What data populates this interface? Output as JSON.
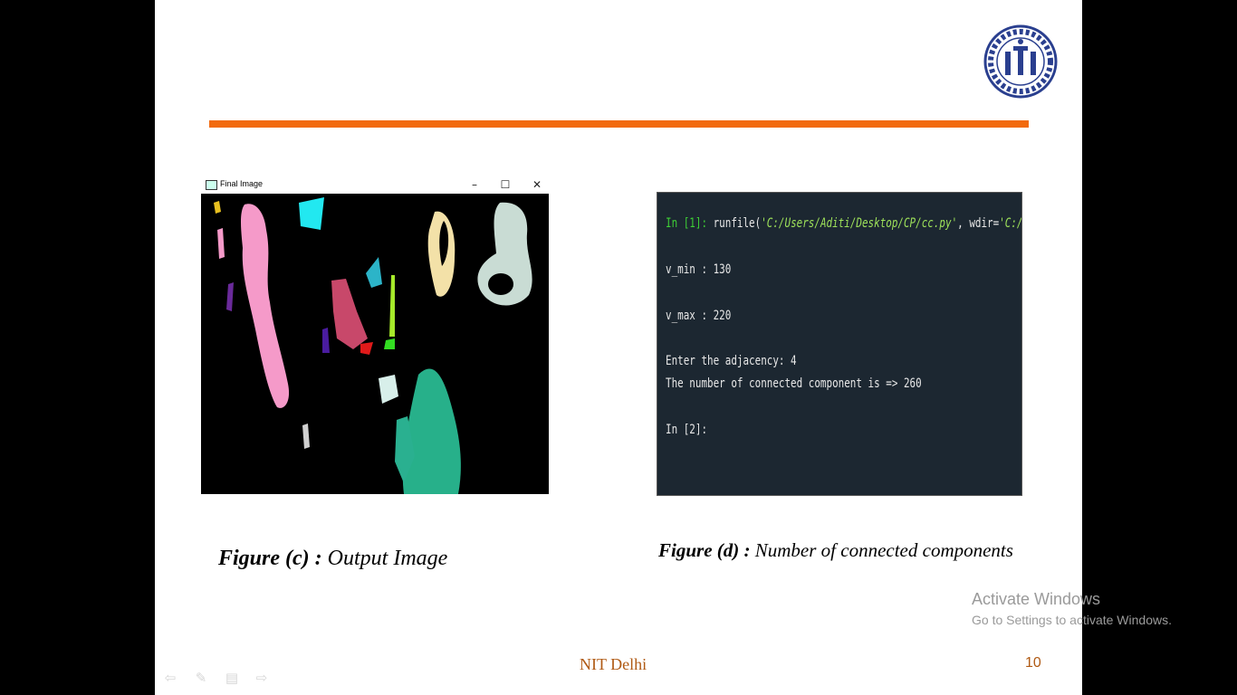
{
  "window": {
    "title": "Final Image",
    "minimize_symbol": "–",
    "maximize_symbol": "☐",
    "close_symbol": "✕"
  },
  "console": {
    "lines": [
      {
        "prompt": "In [1]:",
        "code_pre": " runfile(",
        "str1": "'C:/Users/Aditi/Desktop/CP/cc.py'",
        "code_mid": ", wdir=",
        "str2": "'C:/Users/Aditi"
      },
      {
        "text": "v_min : 130"
      },
      {
        "text": "v_max : 220"
      },
      {
        "text": "Enter the adjacency: 4"
      },
      {
        "text": "The number of connected component is => 260"
      },
      {
        "prompt": "In [2]:"
      }
    ]
  },
  "captions": {
    "c_label": "Figure (c) :",
    "c_text": " Output Image",
    "d_label": "Figure (d) :",
    "d_text": "  Number of connected components"
  },
  "footer": {
    "org": "NIT Delhi",
    "page_number": "10"
  },
  "activation": {
    "line1": "Activate Windows",
    "line2": "Go to Settings to activate Windows."
  },
  "nav_icons": [
    "back-arrow-icon",
    "pen-icon",
    "menu-icon",
    "forward-arrow-icon"
  ],
  "colors": {
    "accent_rule": "#f26a0d",
    "console_bg": "#1c2731",
    "prompt_green": "#3ecf35",
    "footer_text": "#b05a14"
  }
}
